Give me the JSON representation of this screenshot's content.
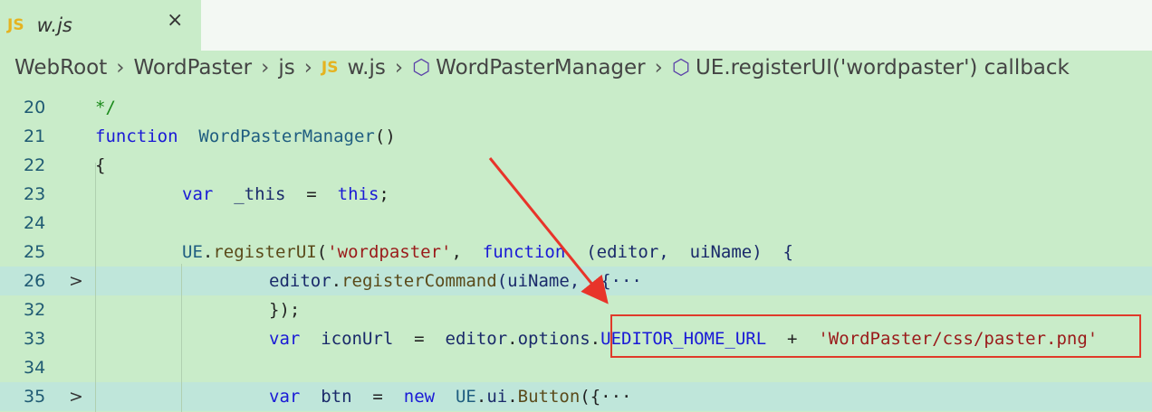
{
  "tab": {
    "icon": "JS",
    "name": "w.js",
    "close": "×"
  },
  "breadcrumb": [
    "WebRoot",
    "WordPaster",
    "js",
    "w.js",
    "WordPasterManager",
    "UE.registerUI('wordpaster') callback"
  ],
  "breadcrumb_js_icon": "JS",
  "lines": [
    {
      "n": "20",
      "indent": 0,
      "tokens": [
        [
          "*/",
          "c"
        ]
      ]
    },
    {
      "n": "21",
      "indent": 0,
      "tokens": [
        [
          "function",
          "k"
        ],
        [
          "  ",
          ""
        ],
        [
          "WordPasterManager",
          "t"
        ],
        [
          "()",
          "p"
        ]
      ]
    },
    {
      "n": "22",
      "indent": 0,
      "tokens": [
        [
          "{",
          "p"
        ]
      ]
    },
    {
      "n": "23",
      "indent": 1,
      "tokens": [
        [
          "var",
          "k"
        ],
        [
          "  ",
          ""
        ],
        [
          "_this",
          "v"
        ],
        [
          "  =  ",
          "p"
        ],
        [
          "this",
          "k"
        ],
        [
          ";",
          "p"
        ]
      ]
    },
    {
      "n": "24",
      "indent": 0,
      "tokens": []
    },
    {
      "n": "25",
      "indent": 1,
      "tokens": [
        [
          "UE",
          "t"
        ],
        [
          ".",
          "p"
        ],
        [
          "registerUI",
          "f"
        ],
        [
          "(",
          "p"
        ],
        [
          "'wordpaster'",
          "s"
        ],
        [
          ",  ",
          "p"
        ],
        [
          "function",
          "k"
        ],
        [
          "  (editor,  uiName)  {",
          "v"
        ]
      ]
    },
    {
      "n": "26",
      "indent": 2,
      "fold": true,
      "hl": true,
      "tokens": [
        [
          "editor",
          "v"
        ],
        [
          ".",
          "p"
        ],
        [
          "registerCommand",
          "f"
        ],
        [
          "(uiName,  {···",
          "v"
        ]
      ]
    },
    {
      "n": "32",
      "indent": 2,
      "tokens": [
        [
          "});",
          "p"
        ]
      ]
    },
    {
      "n": "33",
      "indent": 2,
      "tokens": [
        [
          "var",
          "k"
        ],
        [
          "  ",
          ""
        ],
        [
          "iconUrl",
          "v"
        ],
        [
          "  =  ",
          "p"
        ],
        [
          "editor",
          "v"
        ],
        [
          ".",
          "p"
        ],
        [
          "options",
          "v"
        ],
        [
          ".",
          "p"
        ],
        [
          "UEDITOR_HOME_URL",
          "k"
        ],
        [
          "  +  ",
          "p"
        ],
        [
          "'WordPaster/css/paster.png'",
          "s"
        ]
      ]
    },
    {
      "n": "34",
      "indent": 0,
      "tokens": []
    },
    {
      "n": "35",
      "indent": 2,
      "fold": true,
      "hl": true,
      "tokens": [
        [
          "var",
          "k"
        ],
        [
          "  ",
          ""
        ],
        [
          "btn",
          "v"
        ],
        [
          "  =  ",
          "p"
        ],
        [
          "new",
          "k"
        ],
        [
          "  ",
          ""
        ],
        [
          "UE",
          "t"
        ],
        [
          ".",
          "p"
        ],
        [
          "ui",
          "v"
        ],
        [
          ".",
          "p"
        ],
        [
          "Button",
          "f"
        ],
        [
          "({···",
          "p"
        ]
      ]
    }
  ],
  "fold_icon": ">",
  "colors": {
    "background": "#c9ecc9",
    "highlight_box": "#e03a2a"
  }
}
